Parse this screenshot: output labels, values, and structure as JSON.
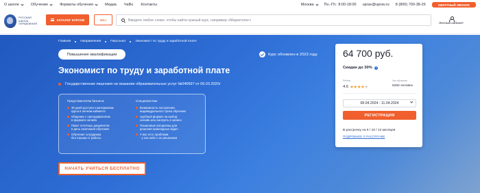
{
  "topnav": {
    "left": [
      "О школе",
      "Обучение",
      "Форматы обучения",
      "Медиа",
      "ЧаВо",
      "Контакты"
    ],
    "city": "Москва",
    "hours": "Пн.-Пт.: 8:00-18:00",
    "email": "uprav@uprav.ru",
    "phone": "8 (800) 700-38-26",
    "callback": "ОБРАТНЫЙ ЗВОНОК"
  },
  "header": {
    "logo_lines": [
      "РУССКАЯ",
      "ШКОЛА",
      "УПРАВЛЕНИЯ"
    ],
    "catalog_label": "КАТАЛОГ КУРСОВ",
    "mba_label": "MBA",
    "search_placeholder": "Введите любое слово, чтобы найти нужный курс, например «Маркетолог»",
    "cabinet_label": "Личный кабинет"
  },
  "hero": {
    "breadcrumbs": [
      "Главная",
      "Направления",
      "Персонал",
      "Экономист по труду и заработной плате"
    ],
    "pill": "Повышение квалификации",
    "updated": "Курс обновлен в 2023 году",
    "title": "Экономист по труду и заработной плате",
    "license": "Государственная лицензия на оказание образовательных услуг №040697 от 06.03.2020г",
    "business_heading": "Представителям бизнеса:",
    "business": [
      [
        "30 дней доступа к материалам",
        "курса в личном кабинете"
      ],
      [
        "Общение с преподавателем",
        "в формате онлайн"
      ],
      [
        "Пакет отчетных документов",
        "в день окончания обучения"
      ],
      [
        "Обучение сотрудника",
        "без отрыва от работы"
      ]
    ],
    "specialists_heading": "Специалистам:",
    "specialists": [
      [
        "Возможность построения",
        "индивидуального трека обучения"
      ],
      [
        "Удобный формат на выбор:",
        "онлайн или смотреть в записи"
      ],
      [
        "Пошаговые алгоритмы для",
        "решения прикладных задач"
      ],
      [
        "У вас есть проблема",
        "- у нас кейс с ее решением"
      ]
    ],
    "start_button": "НАЧАТЬ УЧИТЬСЯ БЕСПЛАТНО"
  },
  "card": {
    "price": "64 700 руб.",
    "discount": "Скидки до 30%",
    "discount_info": "i",
    "rating_label": "Рейтинг",
    "rating": "4.6",
    "rating_value": 4.6,
    "rating_max": 5,
    "students_label": "Уже обучились",
    "students": "5260 человек",
    "dates": "08.04.2024 - 11.04.2024",
    "register": "РЕГИСТРАЦИЯ",
    "installment": "В рассрочку на 6 / 10 / 12 месяцев",
    "installment_link": "ПОДРОБНЕЕ О РАССРОЧКЕ"
  }
}
